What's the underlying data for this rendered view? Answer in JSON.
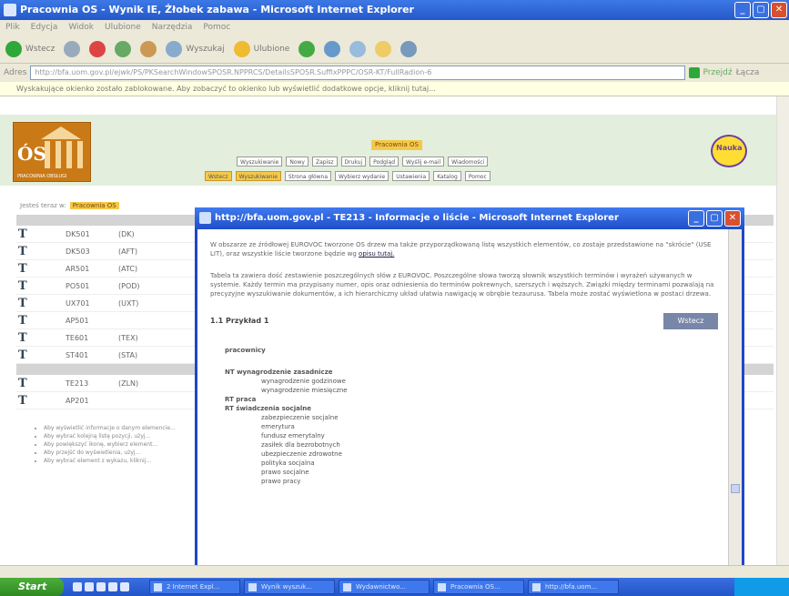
{
  "window": {
    "title": "Pracownia OS - Wynik IE, Żłobek zabawa - Microsoft Internet Explorer",
    "controls": [
      "_",
      "▢",
      "✕"
    ]
  },
  "menu": [
    "Plik",
    "Edycja",
    "Widok",
    "Ulubione",
    "Narzędzia",
    "Pomoc"
  ],
  "toolbar": {
    "back": "Wstecz",
    "search": "Wyszukaj",
    "favorites": "Ulubione"
  },
  "addressbar": {
    "label": "Adres",
    "url": "http://bfa.uom.gov.pl/ejwk/PS/PKSearchWindowSPOSR.NPPRCS/DetailsSPOSR.SuffixPPPC/OSR-KT/FullRadion-6",
    "go": "Przejdź",
    "links": "Łącza"
  },
  "infobar": "Wyskakujące okienko zostało zablokowane. Aby zobaczyć to okienko lub wyświetlić dodatkowe opcje, kliknij tutaj...",
  "banner": {
    "logo_letters": "ÓS",
    "logo_sub": "PRACOWNIA OBSŁUGI",
    "nav_title": "Pracownia OS",
    "nav_row1": [
      "Wyszukiwanie",
      "Nowy",
      "Zapisz",
      "Drukuj",
      "Podgląd",
      "Wyślij e-mail",
      "Wiadomości"
    ],
    "nav_row2": [
      "Wstecz",
      "Wyszukiwanie",
      "Strona główna",
      "Wybierz wydanie",
      "Ustawienia",
      "Katalog",
      "Pomoc"
    ],
    "mascot": "Nauka"
  },
  "breadcrumb": {
    "prefix": "Jesteś teraz w:",
    "current": "Pracownia OS"
  },
  "table": {
    "rows": [
      {
        "code": "DK501",
        "abbr": "(DK)"
      },
      {
        "code": "DK503",
        "abbr": "(AFT)"
      },
      {
        "code": "AR501",
        "abbr": "(ATC)"
      },
      {
        "code": "PO501",
        "abbr": "(POD)"
      },
      {
        "code": "UX701",
        "abbr": "(UXT)"
      },
      {
        "code": "AP501",
        "abbr": ""
      },
      {
        "code": "TE601",
        "abbr": "(TEX)"
      },
      {
        "code": "ST401",
        "abbr": "(STA)"
      }
    ],
    "rows2": [
      {
        "code": "TE213",
        "abbr": "(ZLN)"
      },
      {
        "code": "AP201",
        "abbr": ""
      }
    ]
  },
  "bullets": [
    "Aby wyświetlić informacje o danym elemencie...",
    "Aby wybrać kolejną listę pozycji, użyj...",
    "Aby powiększyć ikonę, wybierz element...",
    "Aby przejść do wyświetlenia, użyj...",
    "Aby wybrać element z wykazu, kliknij..."
  ],
  "popup": {
    "title": "http://bfa.uom.gov.pl - TE213 - Informacje o liście - Microsoft Internet Explorer",
    "para1": "W obszarze ze źródłowej EUROVOC tworzone OS drzew ma także przyporządkowaną listę wszystkich elementów, co zostaje przedstawione na \"skrócie\" (USE LIT), oraz wszystkie liście tworzone będzie wg ",
    "para1_link": "opisu tutaj.",
    "para2": "Tabela ta zawiera dość zestawienie poszczególnych słów z EUROVOC. Poszczególne słowa tworzą słownik wszystkich terminów i wyrażeń używanych w systemie. Każdy termin ma przypisany numer, opis oraz odniesienia do terminów pokrewnych, szerszych i węższych. Związki między terminami pozwalają na precyzyjne wyszukiwanie dokumentów, a ich hierarchiczny układ ułatwia nawigację w obrębie tezaurusa. Tabela może zostać wyświetlona w postaci drzewa.",
    "section_title": "1.1 Przykład 1",
    "next_button": "Wstecz",
    "tree_root": "pracownicy",
    "tree": [
      {
        "kind": "b",
        "text": "NT wynagrodzenie zasadnicze"
      },
      {
        "kind": "sub",
        "text": "wynagrodzenie godzinowe"
      },
      {
        "kind": "sub",
        "text": "wynagrodzenie miesięczne"
      },
      {
        "kind": "b",
        "text": "RT praca"
      },
      {
        "kind": "b",
        "text": "RT świadczenia socjalne"
      },
      {
        "kind": "sub",
        "text": "zabezpieczenie socjalne"
      },
      {
        "kind": "sub",
        "text": "emerytura"
      },
      {
        "kind": "sub",
        "text": "fundusz emerytalny"
      },
      {
        "kind": "sub",
        "text": "zasiłek dla bezrobotnych"
      },
      {
        "kind": "sub",
        "text": "ubezpieczenie zdrowotne"
      },
      {
        "kind": "sub",
        "text": "polityka socjalna"
      },
      {
        "kind": "sub",
        "text": "prawo socjalne"
      },
      {
        "kind": "sub",
        "text": "prawo pracy"
      }
    ]
  },
  "taskbar": {
    "start": "Start",
    "tasks": [
      "2 Internet Expl...",
      "Wynik wyszuk...",
      "Wydawnictwo...",
      "Pracownia OS...",
      "http://bfa.uom..."
    ]
  },
  "colors": {
    "xp_blue": "#2458c9",
    "banner_green": "#e3efdc",
    "highlight": "#f4c84a",
    "popup_border": "#1f48c6",
    "button_gray": "#7886a8"
  }
}
